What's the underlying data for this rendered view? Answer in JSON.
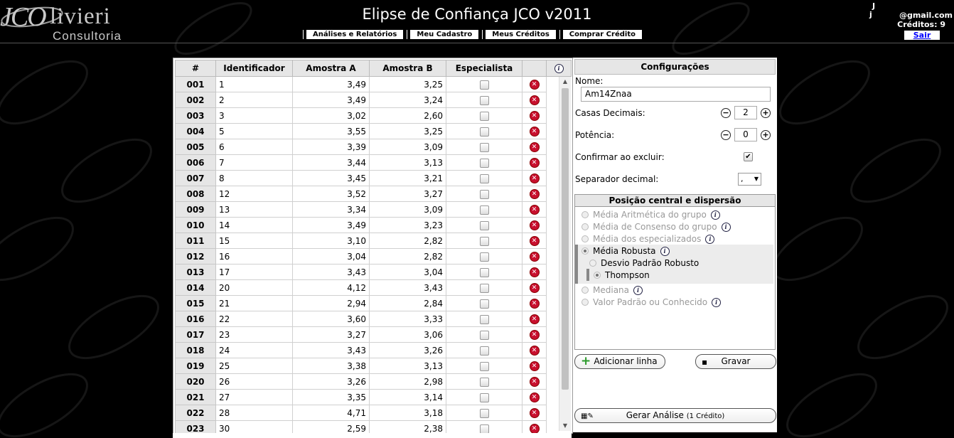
{
  "header": {
    "logo_letters": "JCO",
    "logo_word": "livieri",
    "logo_sub": "Consultoria",
    "title": "Elipse de Confiança JCO v2011",
    "nav": [
      "Análises e Relatórios",
      "Meu Cadastro",
      "Meus Créditos",
      "Comprar Crédito"
    ],
    "user_line1": "J",
    "user_line2": "j",
    "email": "@gmail.com",
    "credits": "Créditos: 9",
    "logout": "Sair"
  },
  "table": {
    "columns": [
      "#",
      "Identificador",
      "Amostra A",
      "Amostra B",
      "Especialista"
    ],
    "rows": [
      {
        "n": "001",
        "id": "1",
        "a": "3,49",
        "b": "3,25"
      },
      {
        "n": "002",
        "id": "2",
        "a": "3,49",
        "b": "3,24"
      },
      {
        "n": "003",
        "id": "3",
        "a": "3,02",
        "b": "2,60"
      },
      {
        "n": "004",
        "id": "5",
        "a": "3,55",
        "b": "3,25"
      },
      {
        "n": "005",
        "id": "6",
        "a": "3,39",
        "b": "3,09"
      },
      {
        "n": "006",
        "id": "7",
        "a": "3,44",
        "b": "3,13"
      },
      {
        "n": "007",
        "id": "8",
        "a": "3,45",
        "b": "3,21"
      },
      {
        "n": "008",
        "id": "12",
        "a": "3,52",
        "b": "3,27"
      },
      {
        "n": "009",
        "id": "13",
        "a": "3,34",
        "b": "3,09"
      },
      {
        "n": "010",
        "id": "14",
        "a": "3,49",
        "b": "3,23"
      },
      {
        "n": "011",
        "id": "15",
        "a": "3,10",
        "b": "2,82"
      },
      {
        "n": "012",
        "id": "16",
        "a": "3,04",
        "b": "2,82"
      },
      {
        "n": "013",
        "id": "17",
        "a": "3,43",
        "b": "3,04"
      },
      {
        "n": "014",
        "id": "20",
        "a": "4,12",
        "b": "3,43"
      },
      {
        "n": "015",
        "id": "21",
        "a": "2,94",
        "b": "2,84"
      },
      {
        "n": "016",
        "id": "22",
        "a": "3,60",
        "b": "3,33"
      },
      {
        "n": "017",
        "id": "23",
        "a": "3,27",
        "b": "3,06"
      },
      {
        "n": "018",
        "id": "24",
        "a": "3,43",
        "b": "3,26"
      },
      {
        "n": "019",
        "id": "25",
        "a": "3,38",
        "b": "3,13"
      },
      {
        "n": "020",
        "id": "26",
        "a": "3,26",
        "b": "2,98"
      },
      {
        "n": "021",
        "id": "27",
        "a": "3,35",
        "b": "3,14"
      },
      {
        "n": "022",
        "id": "28",
        "a": "4,71",
        "b": "3,18"
      },
      {
        "n": "023",
        "id": "30",
        "a": "2,59",
        "b": "2,38"
      }
    ]
  },
  "config": {
    "title": "Configurações",
    "name_label": "Nome:",
    "name_value": "Am14Znaa",
    "decimals_label": "Casas Decimais:",
    "decimals_value": "2",
    "power_label": "Potência:",
    "power_value": "0",
    "confirm_label": "Confirmar ao excluir:",
    "separator_label": "Separador decimal:",
    "separator_value": ",",
    "group_title": "Posição central e dispersão",
    "options": {
      "media_aritmetica": "Média Aritmética do grupo",
      "media_consenso": "Média de Consenso do grupo",
      "media_especializados": "Média dos especializados",
      "media_robusta": "Média Robusta",
      "desvio_robusto": "Desvio Padrão Robusto",
      "thompson": "Thompson",
      "mediana": "Mediana",
      "valor_padrao": "Valor Padrão ou Conhecido"
    },
    "add_line": "Adicionar linha",
    "save": "Gravar",
    "generate": "Gerar Análise",
    "generate_cost": "(1 Crédito)"
  },
  "icons": {
    "delete": "delete-icon",
    "info": "info-icon",
    "minus": "minus-icon",
    "plus": "plus-icon"
  },
  "colors": {
    "background": "#000000",
    "panel": "#ffffff",
    "delete": "#c8102e",
    "add": "#2a9a2a"
  }
}
